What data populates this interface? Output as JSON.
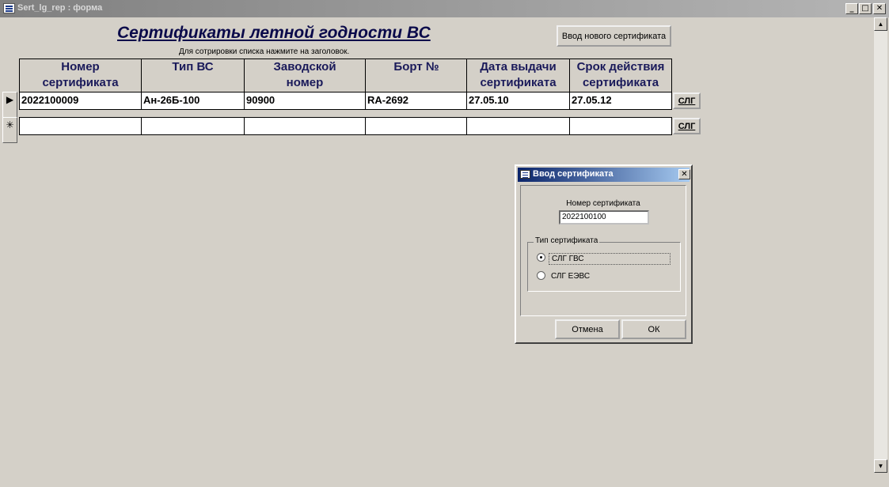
{
  "window": {
    "title": "Sert_lg_rep : форма",
    "controls": {
      "minimize": "_",
      "maximize": "□",
      "close": "✕"
    }
  },
  "form": {
    "title": "Сертификаты летной годности ВС",
    "sort_hint": "Для сотрировки списка нажмите на заголовок.",
    "new_certificate_button": "Ввод нового сертификата"
  },
  "grid": {
    "columns": [
      "Номер\nсертификата",
      "Тип ВС",
      "Заводской\nномер",
      "Борт №",
      "Дата выдачи\nсертификата",
      "Срок действия\nсертификата"
    ],
    "rows": [
      {
        "selector": "▶",
        "cells": [
          "2022100009",
          "Ан-26Б-100",
          "90900",
          "RA-2692",
          "27.05.10",
          "27.05.12"
        ],
        "button": "СЛГ"
      },
      {
        "selector": "✳",
        "cells": [
          "",
          "",
          "",
          "",
          "",
          ""
        ],
        "button": "СЛГ"
      }
    ]
  },
  "dialog": {
    "title": "Ввод сертификата",
    "close": "✕",
    "number_label": "Номер сертификата",
    "number_value": "2022100100",
    "group_caption": "Тип сертификата",
    "options": [
      {
        "label": "СЛГ ГВС",
        "checked": true
      },
      {
        "label": "СЛГ ЕЭВС",
        "checked": false
      }
    ],
    "cancel_button": "Отмена",
    "ok_button": "ОК"
  },
  "scrollbar": {
    "up": "▲",
    "down": "▼"
  }
}
